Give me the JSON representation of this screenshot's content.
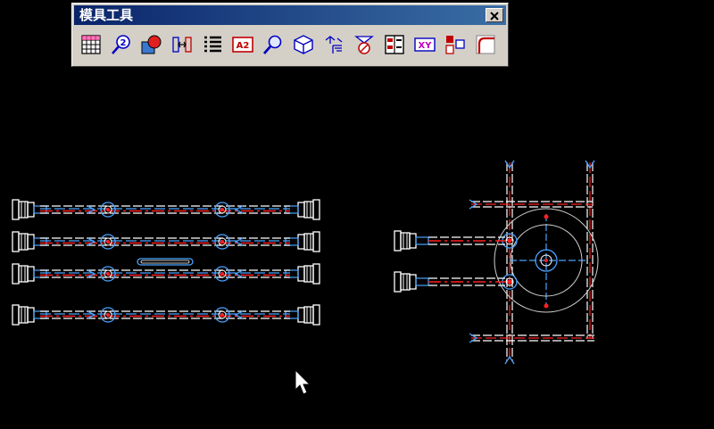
{
  "window": {
    "title": "模具工具",
    "close_icon": "close-icon"
  },
  "toolbar": {
    "tools": [
      {
        "icon": "grid-table-icon"
      },
      {
        "icon": "zoom-two-icon"
      },
      {
        "icon": "color-fill-icon"
      },
      {
        "icon": "dimension-icon"
      },
      {
        "icon": "list-icon"
      },
      {
        "icon": "text-label-icon"
      },
      {
        "icon": "search-icon"
      },
      {
        "icon": "cube-3d-icon"
      },
      {
        "icon": "layer-split-icon"
      },
      {
        "icon": "measure-icon"
      },
      {
        "icon": "panel-list-icon"
      },
      {
        "icon": "xy-coordinate-icon"
      },
      {
        "icon": "align-blocks-icon"
      },
      {
        "icon": "corner-fillet-icon"
      }
    ]
  },
  "colors": {
    "background": "#000000",
    "toolbar_face": "#d4d0c8",
    "title_bar": "#0a246a",
    "drawing_white": "#ffffff",
    "drawing_red": "#ff2020",
    "drawing_cyan": "#4aa3ff"
  },
  "cursor": {
    "icon": "arrow-cursor-icon"
  }
}
